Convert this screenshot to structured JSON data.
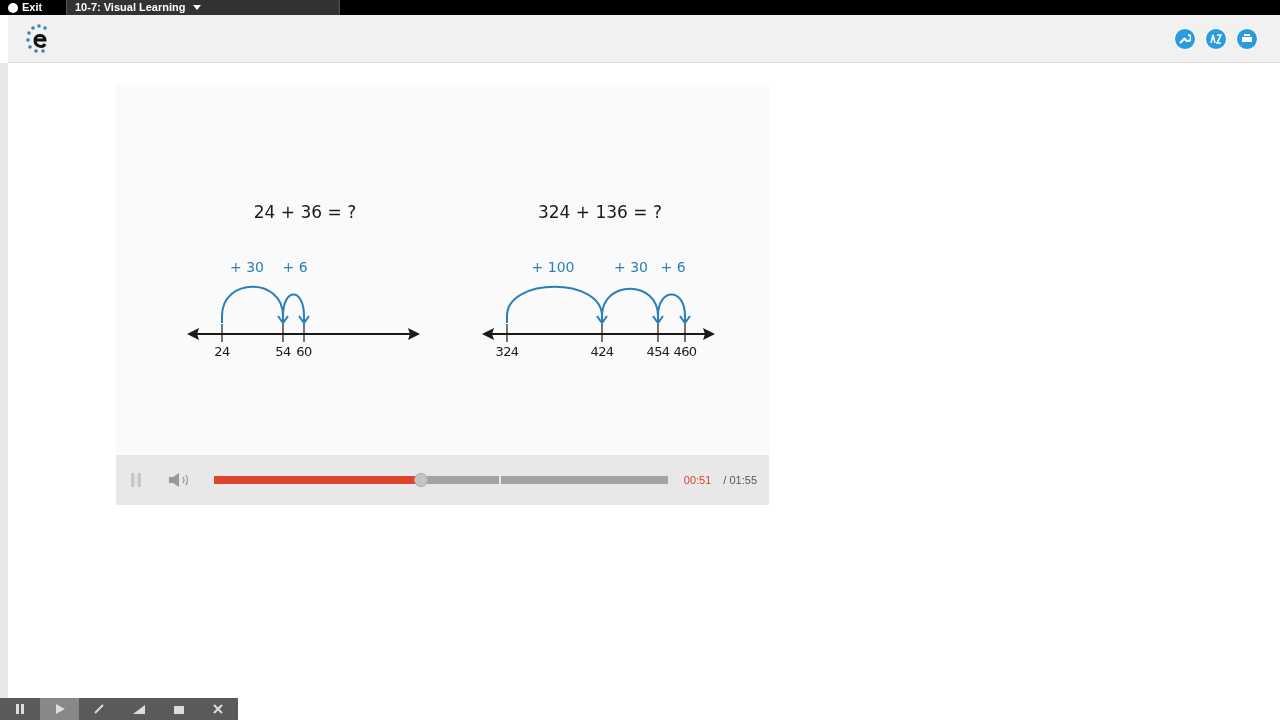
{
  "top_bar": {
    "exit_label": "Exit",
    "lesson_title": "10-7: Visual Learning"
  },
  "problems": [
    {
      "equation": "24 + 36 = ?",
      "jumps": [
        "+ 30",
        "+ 6"
      ],
      "ticks": [
        "24",
        "54",
        "60"
      ]
    },
    {
      "equation": "324 + 136 = ?",
      "jumps": [
        "+ 100",
        "+ 30",
        "+ 6"
      ],
      "ticks": [
        "324",
        "424",
        "454",
        "460"
      ]
    }
  ],
  "player": {
    "playing": true,
    "level": 0.457,
    "elapsed": "00:51",
    "duration": "/ 01:55"
  },
  "annotation_toolbar": {
    "tools": [
      {
        "kind": "pause",
        "selected": false
      },
      {
        "kind": "pointer",
        "selected": true
      },
      {
        "kind": "pen",
        "selected": false
      },
      {
        "kind": "highlighter",
        "selected": false
      },
      {
        "kind": "eraser",
        "selected": false
      },
      {
        "kind": "close",
        "selected": false
      }
    ]
  }
}
